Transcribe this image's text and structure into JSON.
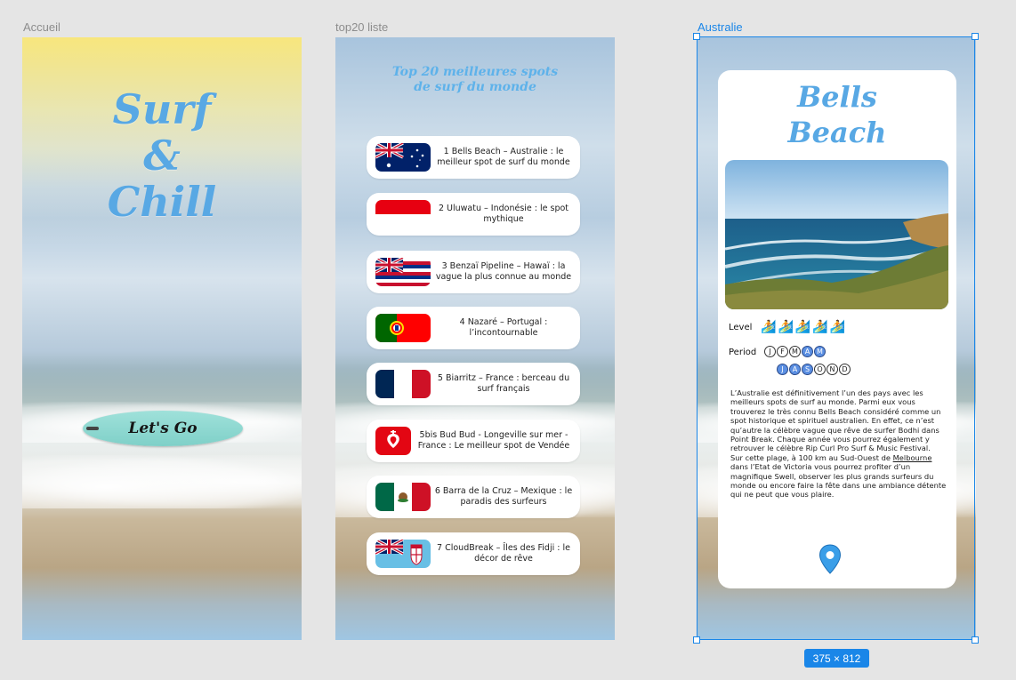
{
  "frames": {
    "accueil": {
      "label": "Accueil",
      "title_lines": [
        "Surf",
        "&",
        "Chill"
      ],
      "button_label": "Let's Go"
    },
    "top20": {
      "label": "top20 liste",
      "title": "Top 20 meilleures spots  de surf du monde",
      "spots": [
        {
          "flag": "australia-flag",
          "text": "1 Bells Beach – Australie : le meilleur spot de surf du monde"
        },
        {
          "flag": "indonesia-flag",
          "text": "2 Uluwatu – Indonésie : le spot mythique"
        },
        {
          "flag": "hawaii-flag",
          "text": "3 Benzaï Pipeline – Hawaï : la vague la plus connue au monde"
        },
        {
          "flag": "portugal-flag",
          "text": "4 Nazaré – Portugal : l’incontournable"
        },
        {
          "flag": "france-flag",
          "text": "5 Biarritz – France : berceau du surf français"
        },
        {
          "flag": "vendee-flag",
          "text": "5bis Bud Bud - Longeville sur mer - France : Le meilleur spot de Vendée"
        },
        {
          "flag": "mexico-flag",
          "text": "6 Barra de la Cruz – Mexique : le paradis des surfeurs"
        },
        {
          "flag": "fiji-flag",
          "text": "7 CloudBreak – Îles des Fidji : le décor de rêve"
        }
      ]
    },
    "australie": {
      "label": "Australie",
      "size_badge": "375 × 812",
      "title_lines": [
        "Bells",
        "Beach"
      ],
      "level_label": "Level",
      "level": 5,
      "period_label": "Period",
      "months_row1": [
        {
          "l": "J",
          "on": false
        },
        {
          "l": "F",
          "on": false
        },
        {
          "l": "M",
          "on": false
        },
        {
          "l": "A",
          "on": true
        },
        {
          "l": "M",
          "on": true
        }
      ],
      "months_row2": [
        {
          "l": "J",
          "on": true
        },
        {
          "l": "A",
          "on": true
        },
        {
          "l": "S",
          "on": true
        },
        {
          "l": "O",
          "on": false
        },
        {
          "l": "N",
          "on": false
        },
        {
          "l": "D",
          "on": false
        }
      ],
      "desc_p1": "L’Australie est définitivement l’un des pays avec les meilleurs spots de surf au monde. Parmi eux vous trouverez le très connu Bells Beach considéré comme un spot historique et spirituel australien. En effet, ce n’est qu’autre la célèbre vague que rêve de surfer Bodhi dans Point Break. Chaque année vous pourrez également y retrouver le célèbre Rip Curl Pro Surf & Music Festival.",
      "desc_p2_before": "Sur cette plage, à 100 km au Sud-Ouest de ",
      "desc_p2_link": "Melbourne",
      "desc_p2_after": " dans l’Etat de Victoria vous pourrez profiter d’un magnifique Swell, observer les plus grands surfeurs du monde ou encore faire la fête dans une ambiance détente qui ne peut que vous plaire."
    }
  },
  "colors": {
    "title_blue": "#58a8e4",
    "selection_blue": "#1a86e8",
    "month_on": "#5b8fe2"
  }
}
